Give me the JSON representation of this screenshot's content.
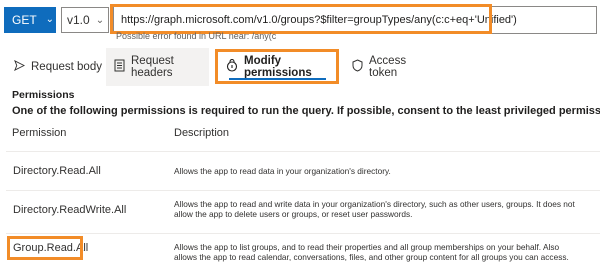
{
  "toolbar": {
    "method": "GET",
    "version": "v1.0",
    "url": "https://graph.microsoft.com/v1.0/groups?$filter=groupTypes/any(c:c+eq+'Unified')",
    "url_error": "Possible error found in URL near: /any(c"
  },
  "tabs": [
    {
      "label": "Request body",
      "icon": "send-icon"
    },
    {
      "label": "Request headers",
      "icon": "document-icon"
    },
    {
      "label": "Modify permissions",
      "icon": "lock-icon",
      "selected": true
    },
    {
      "label": "Access token",
      "icon": "shield-icon"
    }
  ],
  "permissions": {
    "title": "Permissions",
    "info": "One of the following permissions is required to run the query. If possible, consent to the least privileged permission.",
    "columns": {
      "permission": "Permission",
      "description": "Description"
    },
    "rows": [
      {
        "name": "Directory.Read.All",
        "desc1": "Allows the app to read data in your organization's directory.",
        "desc2": ""
      },
      {
        "name": "Directory.ReadWrite.All",
        "desc1": "Allows the app to read and write data in your organization's directory, such as other users, groups. It does not",
        "desc2": "allow the app to delete users or groups, or reset user passwords."
      },
      {
        "name": "Group.Read.All",
        "desc1": "Allows the app to list groups, and to read their properties and all group memberships on your behalf. Also",
        "desc2": "allows the app to read calendar, conversations, files, and other group content for all groups you can access."
      }
    ]
  },
  "colors": {
    "accent": "#0f6cbd",
    "highlight": "#f28c28"
  }
}
